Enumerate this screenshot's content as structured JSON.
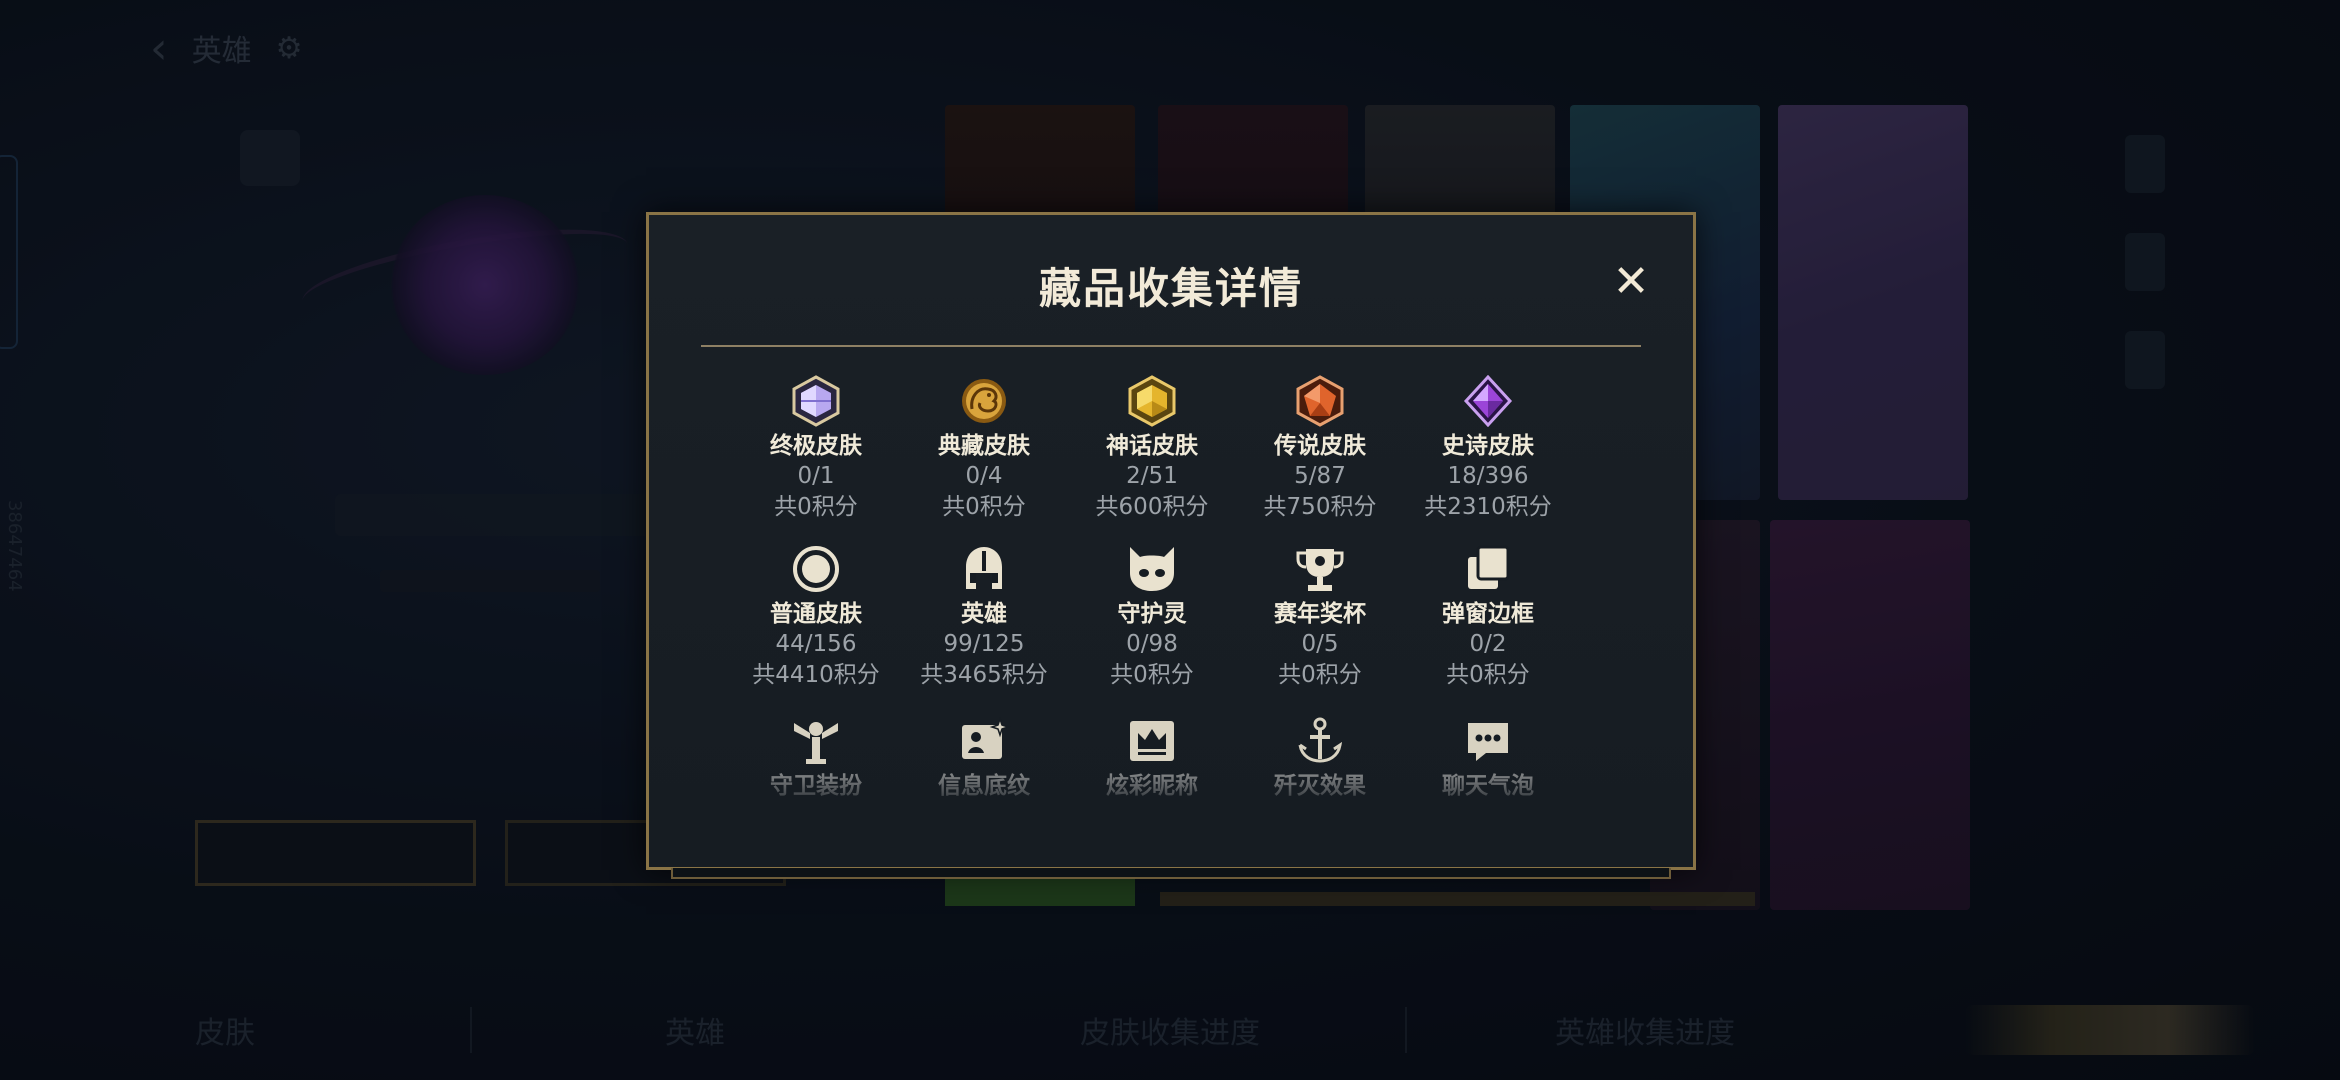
{
  "background": {
    "top_back_label": "英雄",
    "vertical_id": "38647464",
    "bottom_tabs": [
      "皮肤",
      "英雄",
      "皮肤收集进度",
      "英雄收集进度"
    ]
  },
  "modal": {
    "title": "藏品收集详情",
    "close_symbol": "✕",
    "items": [
      {
        "label": "终极皮肤",
        "count": "0/1",
        "points": "共0积分",
        "icon": "ultimate-skin-gem-icon",
        "color": "#b8a8f0"
      },
      {
        "label": "典藏皮肤",
        "count": "0/4",
        "points": "共0积分",
        "icon": "collection-dragon-icon",
        "color": "#d9a43c"
      },
      {
        "label": "神话皮肤",
        "count": "2/51",
        "points": "共600积分",
        "icon": "mythic-skin-gem-icon",
        "color": "#e5b52c"
      },
      {
        "label": "传说皮肤",
        "count": "5/87",
        "points": "共750积分",
        "icon": "legendary-skin-gem-icon",
        "color": "#e0642c"
      },
      {
        "label": "史诗皮肤",
        "count": "18/396",
        "points": "共2310积分",
        "icon": "epic-skin-gem-icon",
        "color": "#9b45d8"
      },
      {
        "label": "普通皮肤",
        "count": "44/156",
        "points": "共4410积分",
        "icon": "normal-skin-ring-icon",
        "color": "#e9e2cf"
      },
      {
        "label": "英雄",
        "count": "99/125",
        "points": "共3465积分",
        "icon": "hero-helmet-icon",
        "color": "#e9e2cf"
      },
      {
        "label": "守护灵",
        "count": "0/98",
        "points": "共0积分",
        "icon": "guardian-spirit-icon",
        "color": "#e9e2cf"
      },
      {
        "label": "赛年奖杯",
        "count": "0/5",
        "points": "共0积分",
        "icon": "season-trophy-icon",
        "color": "#e9e2cf"
      },
      {
        "label": "弹窗边框",
        "count": "0/2",
        "points": "共0积分",
        "icon": "popup-frame-icon",
        "color": "#e9e2cf"
      },
      {
        "label": "守卫装扮",
        "icon": "ward-skin-icon",
        "color": "#e9e2cf"
      },
      {
        "label": "信息底纹",
        "icon": "info-card-icon",
        "color": "#e9e2cf"
      },
      {
        "label": "炫彩昵称",
        "icon": "colorful-nickname-icon",
        "color": "#e9e2cf"
      },
      {
        "label": "歼灭效果",
        "icon": "annihilation-effect-icon",
        "color": "#e9e2cf"
      },
      {
        "label": "聊天气泡",
        "icon": "chat-bubble-icon",
        "color": "#e9e2cf"
      }
    ]
  }
}
